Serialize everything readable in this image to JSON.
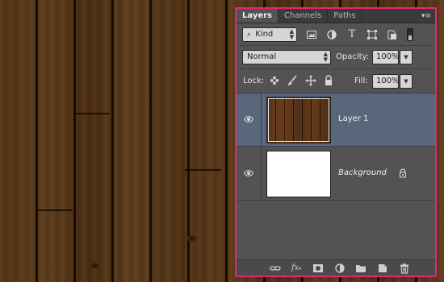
{
  "panel": {
    "tabs": [
      {
        "label": "Layers"
      },
      {
        "label": "Channels"
      },
      {
        "label": "Paths"
      }
    ],
    "menu_icon": "panel-menu-icon"
  },
  "filter": {
    "kind_label": "Kind",
    "icons": [
      "pixel-filter-icon",
      "adjustment-filter-icon",
      "type-filter-icon",
      "shape-filter-icon",
      "smart-object-filter-icon",
      "filter-toggle-icon"
    ]
  },
  "blend": {
    "mode": "Normal",
    "opacity_label": "Opacity:",
    "opacity_value": "100%"
  },
  "lock": {
    "label": "Lock:",
    "fill_label": "Fill:",
    "fill_value": "100%"
  },
  "layers": [
    {
      "name": "Layer 1",
      "selected": true,
      "visible": true
    },
    {
      "name": "Background",
      "selected": false,
      "visible": true,
      "locked": true
    }
  ],
  "bottom_icons": [
    "link-layers-icon",
    "fx-icon",
    "mask-icon",
    "adjustment-layer-icon",
    "group-folder-icon",
    "new-layer-icon",
    "trash-icon"
  ],
  "colors": {
    "panel_border": "#e0287a",
    "panel_bg": "#535353",
    "selected_layer": "#59677b"
  }
}
